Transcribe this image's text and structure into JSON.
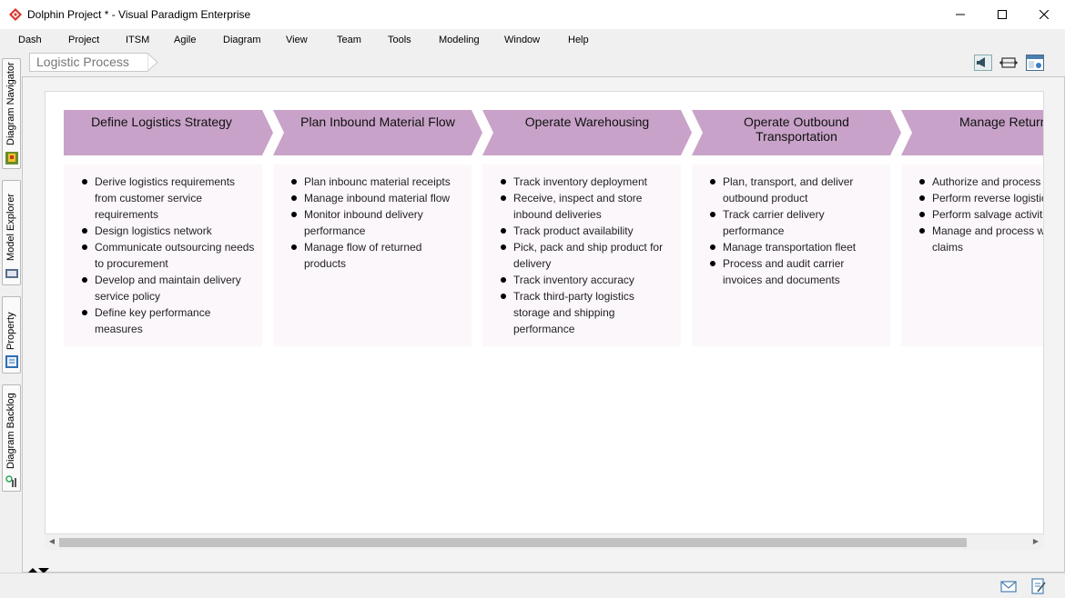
{
  "window": {
    "title": "Dolphin Project * - Visual Paradigm Enterprise"
  },
  "menu": [
    "Dash",
    "Project",
    "ITSM",
    "Agile",
    "Diagram",
    "View",
    "Team",
    "Tools",
    "Modeling",
    "Window",
    "Help"
  ],
  "breadcrumb": {
    "label": "Logistic Process"
  },
  "side_tabs": [
    {
      "label": "Diagram Navigator",
      "icon": "diagram-navigator-icon"
    },
    {
      "label": "Model Explorer",
      "icon": "model-explorer-icon"
    },
    {
      "label": "Property",
      "icon": "property-icon"
    },
    {
      "label": "Diagram Backlog",
      "icon": "diagram-backlog-icon"
    }
  ],
  "colors": {
    "stage_header": "#c8a2c8",
    "stage_body": "#fcf7fb",
    "canvas": "#ffffff"
  },
  "stages": [
    {
      "title": "Define Logistics Strategy",
      "items": [
        "Derive logistics requirements from customer service requirements",
        "Design logistics network",
        "Communicate outsourcing needs to procurement",
        "Develop and maintain delivery service policy",
        "Define key performance measures"
      ]
    },
    {
      "title": "Plan Inbound Material Flow",
      "items": [
        "Plan inbounc material receipts",
        "Manage inbound material flow",
        "Monitor inbound delivery performance",
        "Manage flow of returned products"
      ]
    },
    {
      "title": "Operate Warehousing",
      "items": [
        "Track inventory deployment",
        "Receive, inspect and store inbound deliveries",
        "Track product availability",
        "Pick, pack and ship product for delivery",
        "Track inventory accuracy",
        "Track third-party logistics storage and shipping performance"
      ]
    },
    {
      "title": "Operate Outbound Transportation",
      "items": [
        "Plan, transport, and deliver outbound product",
        "Track carrier delivery performance",
        "Manage transportation fleet",
        "Process and audit carrier invoices and documents"
      ]
    },
    {
      "title": "Manage Returns",
      "items": [
        "Authorize and process returns",
        "Perform reverse logistics",
        "Perform salvage activities",
        "Manage and process warranty claims"
      ]
    }
  ]
}
